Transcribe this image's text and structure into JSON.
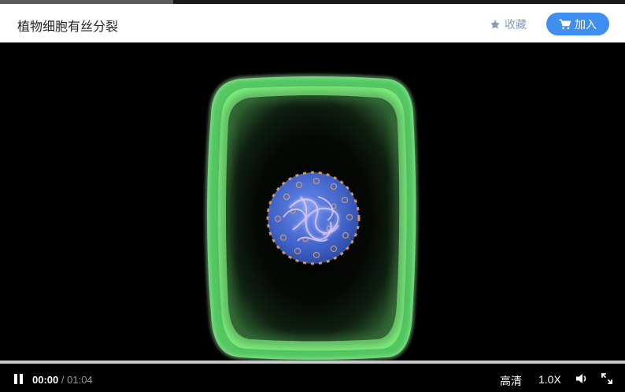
{
  "header": {
    "title": "植物细胞有丝分裂",
    "favorite_label": "收藏",
    "join_label": "加入"
  },
  "player": {
    "current_time": "00:00",
    "separator": "/",
    "duration": "01:04",
    "progress": 0,
    "quality_label": "高清",
    "speed_label": "1.0X"
  },
  "icons": {
    "favorite": "star-icon",
    "join": "cart-icon",
    "play": "pause-icon",
    "volume": "volume-icon",
    "fullscreen": "fullscreen-icon"
  },
  "colors": {
    "accent": "#3f8ff0",
    "favorite_text": "#8a9bb8",
    "cell_wall": "#6ee87a",
    "nucleus": "#4a78d8"
  }
}
